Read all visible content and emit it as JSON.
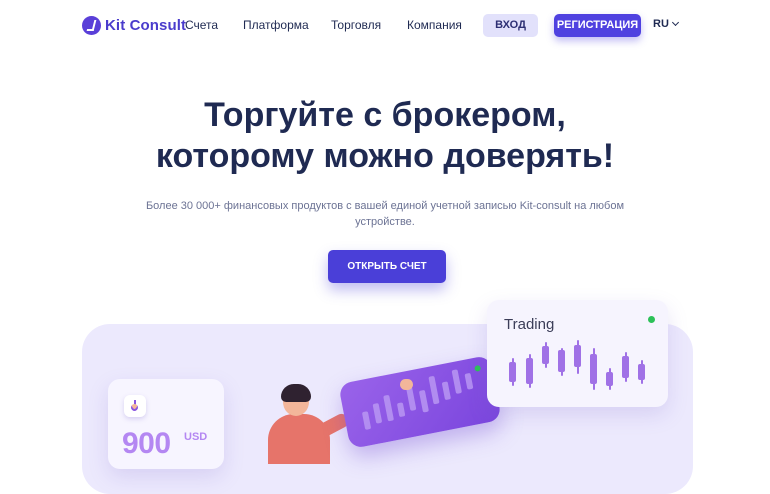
{
  "header": {
    "logo_text": "Kit Consult",
    "nav": [
      "Счета",
      "Платформа",
      "Торговля",
      "Компания"
    ],
    "login_label": "ВХОД",
    "register_label": "РЕГИСТРАЦИЯ",
    "language": "RU"
  },
  "hero": {
    "title_line1": "Торгуйте с брокером,",
    "title_line2": "которому можно доверять!",
    "subtitle": "Более 30 000+ финансовых продуктов с вашей единой учетной записью Kit-consult на любом устройстве.",
    "cta_label": "ОТКРЫТЬ СЧЕТ"
  },
  "illustration": {
    "trading_label": "Trading",
    "deposit_amount": "900",
    "deposit_currency": "USD"
  },
  "colors": {
    "brand": "#4f41e0",
    "text_dark": "#1f2a52",
    "candle": "#a071e6",
    "status_green": "#2cc158",
    "panel_bg": "#ece9fd"
  },
  "icons": [
    "logo-mark-icon",
    "chevron-down-icon",
    "download-arrow-icon"
  ]
}
